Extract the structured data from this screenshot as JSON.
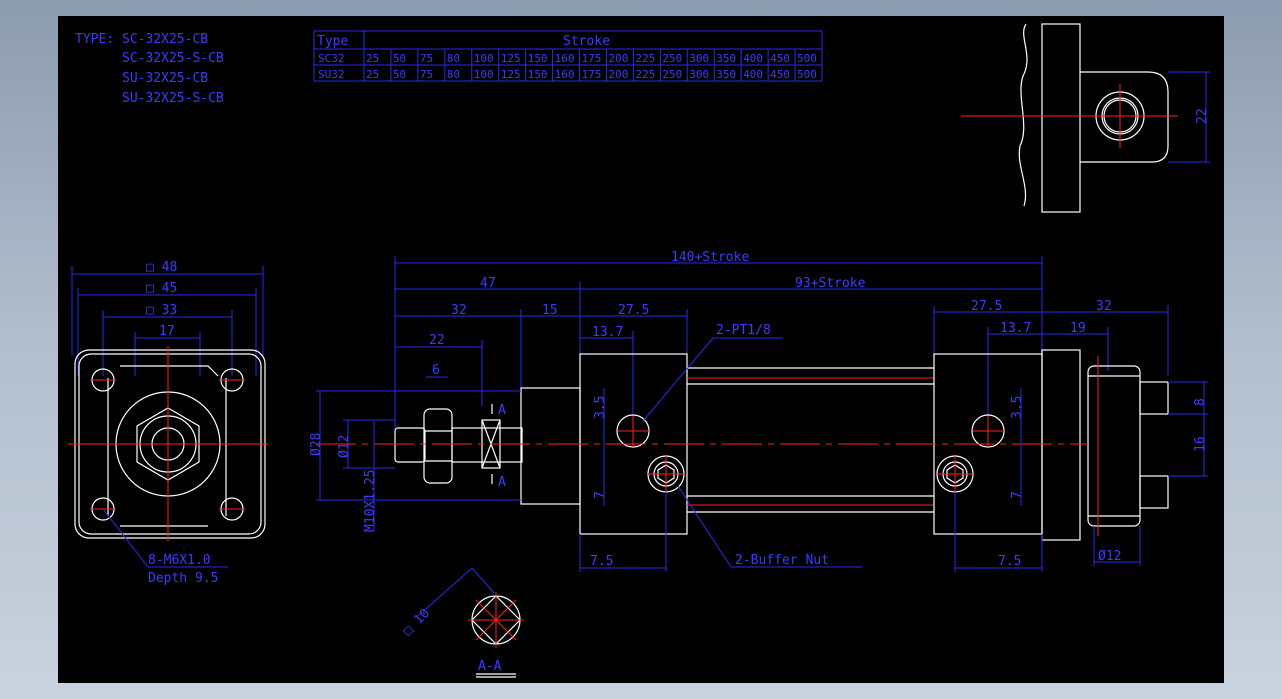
{
  "type_block": {
    "label": "TYPE:",
    "models": [
      "SC-32X25-CB",
      "SC-32X25-S-CB",
      "SU-32X25-CB",
      "SU-32X25-S-CB"
    ]
  },
  "stroke_table": {
    "header_type": "Type",
    "header_stroke": "Stroke",
    "rows": [
      {
        "type": "SC32",
        "values": [
          "25",
          "50",
          "75",
          "80",
          "100",
          "125",
          "150",
          "160",
          "175",
          "200",
          "225",
          "250",
          "300",
          "350",
          "400",
          "450",
          "500"
        ]
      },
      {
        "type": "SU32",
        "values": [
          "25",
          "50",
          "75",
          "80",
          "100",
          "125",
          "150",
          "160",
          "175",
          "200",
          "225",
          "250",
          "300",
          "350",
          "400",
          "450",
          "500"
        ]
      }
    ]
  },
  "front_view": {
    "dim_48": "□ 48",
    "dim_45": "□ 45",
    "dim_33": "□ 33",
    "dim_17": "17",
    "note_line1": "8-M6X1.0",
    "note_line2": "Depth 9.5"
  },
  "side_view": {
    "total_length": "140+Stroke",
    "body_length": "93+Stroke",
    "d47": "47",
    "d32": "32",
    "d15": "15",
    "d27_5_left": "27.5",
    "d22": "22",
    "d6": "6",
    "d13_7_left": "13.7",
    "d27_5_right": "27.5",
    "d13_7_right": "13.7",
    "d19": "19",
    "d32_right": "32",
    "port_note": "2-PT1/8",
    "buffer_note": "2-Buffer  Nut",
    "d3_5_left": "3.5",
    "d7_left": "7",
    "d3_5_right": "3.5",
    "d7_right": "7",
    "d7_5_left": "7.5",
    "d7_5_right": "7.5",
    "dia28": "Ø28",
    "dia12": "Ø12",
    "thread": "M10X1.25",
    "section_mark": "A",
    "d8": "8",
    "d16": "16",
    "pin_dia": "Ø12"
  },
  "top_view": {
    "d22": "22"
  },
  "section": {
    "label": "A-A",
    "square": "□ 10"
  },
  "colors": {
    "background": "#000000",
    "dimension": "#2a2af0",
    "outline": "#ffffff",
    "centerline": "#ff2020"
  }
}
